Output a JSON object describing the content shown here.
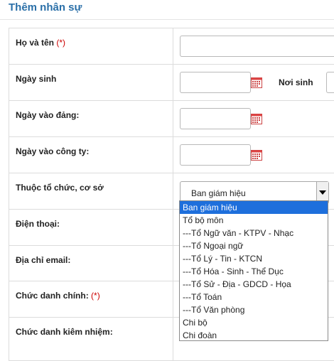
{
  "header": {
    "title": "Thêm nhân sự"
  },
  "form": {
    "full_name": {
      "label": "Họ và tên",
      "required_mark": "(*)"
    },
    "birth_date": {
      "label": "Ngày sinh"
    },
    "birth_place": {
      "label": "Nơi sinh"
    },
    "party_join_date": {
      "label": "Ngày vào đảng:"
    },
    "company_join_date": {
      "label": "Ngày vào công ty:"
    },
    "organization": {
      "label": "Thuộc tổ chức, cơ sở",
      "selected": "Ban giám hiệu"
    },
    "phone": {
      "label": "Điện thoại:"
    },
    "email": {
      "label": "Địa chỉ email:"
    },
    "main_title": {
      "label": "Chức danh chính:",
      "required_mark": "(*)"
    },
    "concurrent_title": {
      "label": "Chức danh kiêm nhiệm:"
    }
  },
  "dropdown": {
    "options": [
      "Ban giám hiệu",
      "Tổ bộ môn",
      "---Tổ Ngữ văn - KTPV - Nhạc",
      "---Tổ Ngoại ngữ",
      "---Tổ Lý - Tin - KTCN",
      "---Tổ Hóa - Sinh - Thể Dục",
      "---Tổ Sử - Địa - GDCD - Họa",
      "---Tổ Toán",
      "---Tổ Văn phòng",
      "Chi bộ",
      "Chi đoàn"
    ],
    "selected_index": 0
  },
  "icons": {
    "calendar": "calendar-icon",
    "dropdown_arrow": "chevron-down-icon"
  },
  "colors": {
    "title": "#2a6fa8",
    "required": "#cc0000",
    "highlight": "#1e6fdc"
  }
}
